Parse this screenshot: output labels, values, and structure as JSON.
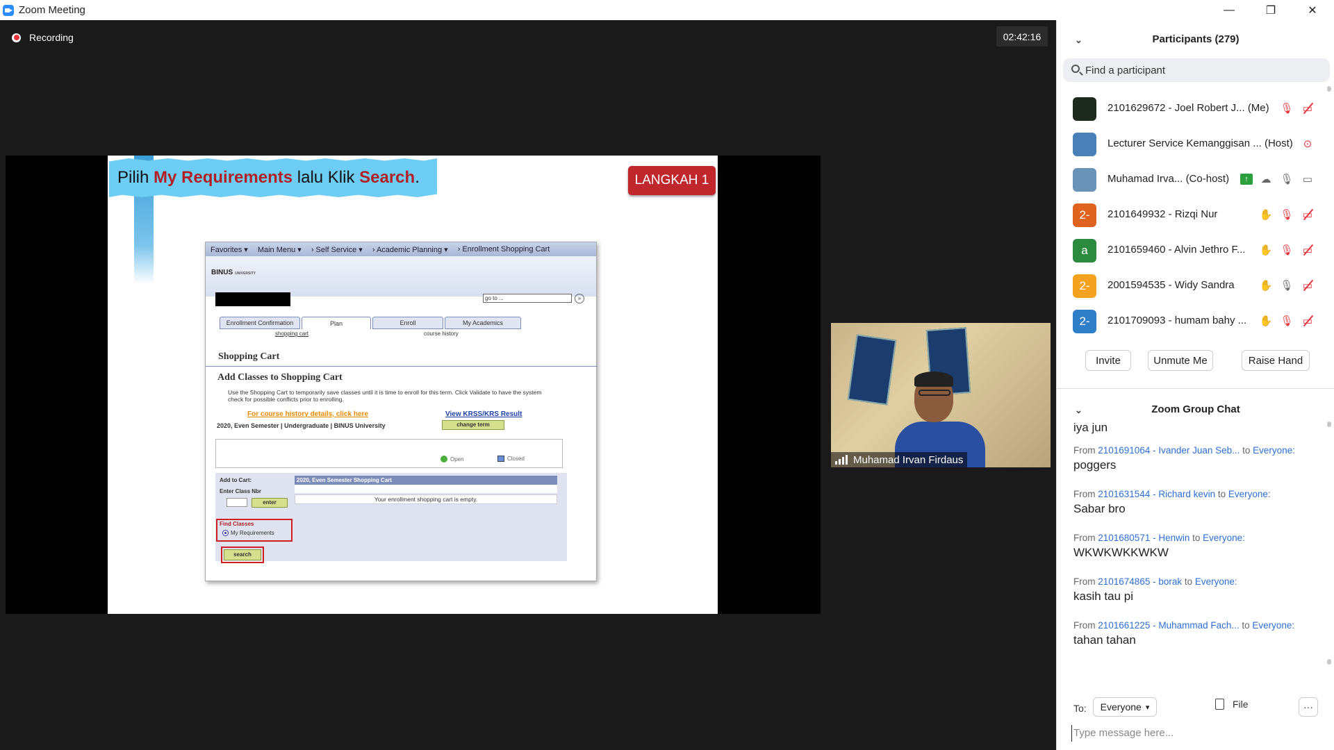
{
  "window": {
    "title": "Zoom Meeting",
    "controls": [
      "minimize-icon",
      "restore-icon",
      "close-icon"
    ]
  },
  "recording": {
    "label": "Recording"
  },
  "timer": "02:42:16",
  "slide": {
    "banner_prefix": "Pilih ",
    "banner_hl1": "My Requirements",
    "banner_mid": " lalu Klik ",
    "banner_hl2": "Search",
    "banner_end": ".",
    "badge": "LANGKAH 1",
    "portal": {
      "nav": [
        "Favorites ▾",
        "Main Menu ▾",
        "›  Self Service ▾",
        "›  Academic Planning ▾",
        "›  Enrollment Shopping Cart"
      ],
      "logo": "BINUS",
      "logo_sub": "UNIVERSITY",
      "goto": "go to ...",
      "tabs": [
        "Enrollment Confirmation",
        "Plan",
        "Enroll",
        "My Academics"
      ],
      "subtabs": [
        "shopping cart",
        "course history"
      ],
      "h1": "Shopping Cart",
      "h2": "Add Classes to Shopping Cart",
      "desc": "Use the Shopping Cart to temporarily save classes until it is time to enroll for this term.  Click Validate to have the system check for possible conflicts prior to enrolling.",
      "history_link": "For course history details, click here",
      "krs_link": "View KRSS/KRS Result",
      "term": "2020, Even Semester | Undergraduate | BINUS University",
      "change_term": "change term",
      "legend_open": "Open",
      "legend_closed": "Closed",
      "add_to_cart": "Add to Cart:",
      "enter_class": "Enter Class Nbr",
      "enter_btn": "enter",
      "cart_title": "2020, Even Semester Shopping Cart",
      "cart_empty": "Your enrollment shopping cart is empty.",
      "find_classes": "Find Classes",
      "my_requirements": "My Requirements",
      "search_btn": "search"
    }
  },
  "video": {
    "name": "Muhamad Irvan Firdaus"
  },
  "participants": {
    "header": "Participants (279)",
    "search_placeholder": "Find a participant",
    "list": [
      {
        "name": "2101629672 - Joel Robert J...",
        "role": "(Me)",
        "avatar_text": "",
        "avatar_color": "#2a3a2a"
      },
      {
        "name": "Lecturer Service Kemanggisan ...",
        "role": "(Host)",
        "avatar_text": "",
        "avatar_color": "#4a7fb8"
      },
      {
        "name": "Muhamad Irva...",
        "role": "(Co-host)",
        "avatar_text": "",
        "avatar_color": "#6a93b8"
      },
      {
        "name": "2101649932 - Rizqi Nur",
        "role": "",
        "avatar_text": "2-",
        "avatar_color": "#e0621f"
      },
      {
        "name": "2101659460 - Alvin Jethro F...",
        "role": "",
        "avatar_text": "a",
        "avatar_color": "#2b8a3e"
      },
      {
        "name": "2001594535 - Widy Sandra",
        "role": "",
        "avatar_text": "2-",
        "avatar_color": "#f4a21f"
      },
      {
        "name": "2101709093 - humam bahy ...",
        "role": "",
        "avatar_text": "2-",
        "avatar_color": "#2e7fc7"
      }
    ],
    "buttons": {
      "invite": "Invite",
      "unmute": "Unmute Me",
      "raise": "Raise Hand"
    }
  },
  "chat": {
    "header": "Zoom Group Chat",
    "partial_text": "iya jun",
    "messages": [
      {
        "from_label": "From ",
        "user": "2101691064 - Ivander Juan Seb...",
        "to_label": " to ",
        "to": "Everyone:",
        "text": "poggers"
      },
      {
        "from_label": "From ",
        "user": "2101631544 - Richard kevin",
        "to_label": " to ",
        "to": "Everyone:",
        "text": "Sabar bro"
      },
      {
        "from_label": "From ",
        "user": "2101680571 - Henwin",
        "to_label": " to ",
        "to": "Everyone:",
        "text": "WKWKWKKWKW"
      },
      {
        "from_label": "From ",
        "user": "2101674865 - borak",
        "to_label": " to ",
        "to": "Everyone:",
        "text": "kasih tau pi"
      },
      {
        "from_label": "From ",
        "user": "2101661225 - Muhammad Fach...",
        "to_label": " to ",
        "to": "Everyone:",
        "text": "tahan tahan"
      }
    ],
    "to_label": "To:",
    "recipient": "Everyone",
    "file_label": "File",
    "more": "···",
    "input_placeholder": "Type message here..."
  }
}
